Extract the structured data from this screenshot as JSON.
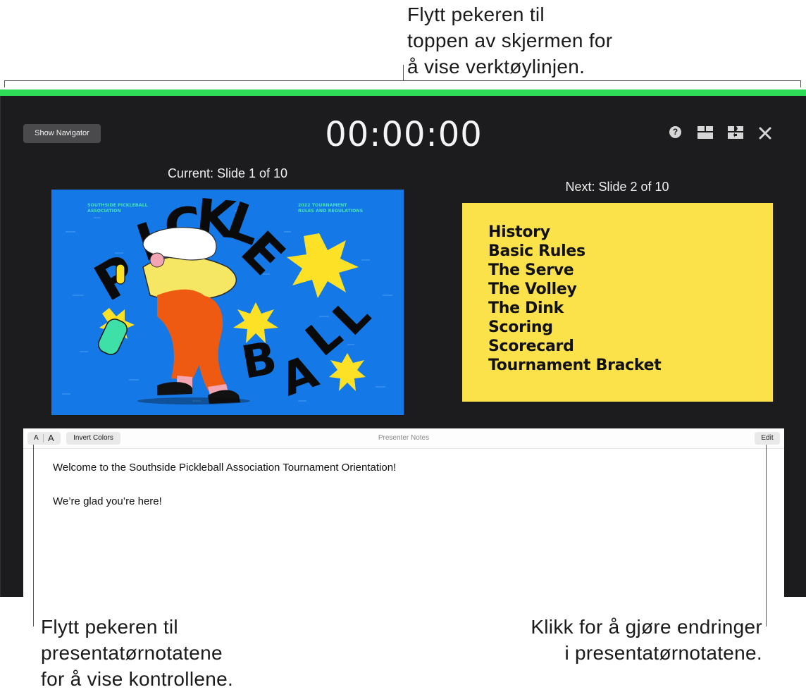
{
  "callouts": {
    "top": [
      "Flytt pekeren til",
      "toppen av skjermen for",
      "å vise verktøylinjen."
    ],
    "bottom_left": [
      "Flytt pekeren til",
      "presentatørnotatene",
      "for å vise kontrollene."
    ],
    "bottom_right": [
      "Klikk for å gjøre endringer",
      "i presentatørnotatene."
    ]
  },
  "toolbar": {
    "show_navigator": "Show Navigator",
    "timer": "00:00:00",
    "help_glyph": "?"
  },
  "current": {
    "label": "Current: Slide 1 of 10",
    "slide": {
      "association": [
        "SOUTHSIDE PICKLEBALL",
        "ASSOCIATION"
      ],
      "event": [
        "2022 TOURNAMENT",
        "RULES AND REGULATIONS"
      ],
      "title_letters": [
        "P",
        "I",
        "C",
        "K",
        "L",
        "E"
      ],
      "ball_letters": [
        "B",
        "A",
        "L",
        "L"
      ]
    }
  },
  "next": {
    "label": "Next: Slide 2 of 10",
    "items": [
      "History",
      "Basic Rules",
      "The Serve",
      "The Volley",
      "The Dink",
      "Scoring",
      "Scorecard",
      "Tournament Bracket"
    ]
  },
  "notes": {
    "font_small": "A",
    "font_large": "A",
    "invert": "Invert Colors",
    "title": "Presenter Notes",
    "edit": "Edit",
    "paragraphs": [
      "Welcome to the Southside Pickleball Association Tournament Orientation!",
      "We’re glad you’re here!"
    ]
  },
  "colors": {
    "accent_bar": "#2fdc57",
    "slide_blue": "#1478e6",
    "slide_yellow": "#fbe14a",
    "window_bg": "#1c1c1e"
  }
}
